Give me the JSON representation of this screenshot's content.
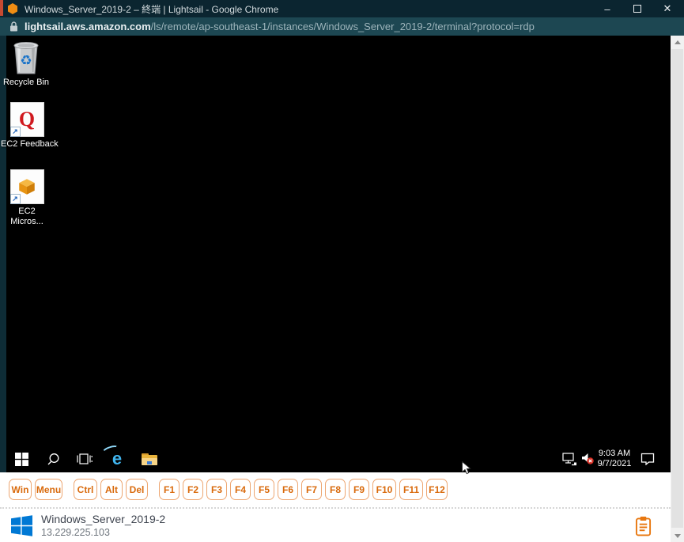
{
  "browser": {
    "title": "Windows_Server_2019-2 – 終端 | Lightsail - Google Chrome",
    "controls": {
      "minimize": "–",
      "close": "✕"
    },
    "url": {
      "domain": "lightsail.aws.amazon.com",
      "path": "/ls/remote/ap-southeast-1/instances/Windows_Server_2019-2/terminal?protocol=rdp"
    }
  },
  "desktop": {
    "icons": [
      {
        "label": "Recycle Bin"
      },
      {
        "label": "EC2 Feedback",
        "glyph": "Q"
      },
      {
        "label_line1": "EC2",
        "label_line2": "Micros..."
      }
    ],
    "taskbar": {
      "clock": {
        "time": "9:03 AM",
        "date": "9/7/2021"
      }
    }
  },
  "icons": {
    "shortcut_arrow": "↗",
    "recycle_symbol": "♻",
    "ie_letter": "e"
  },
  "virtual_keys": {
    "items": [
      "Win",
      "Menu",
      "Ctrl",
      "Alt",
      "Del",
      "F1",
      "F2",
      "F3",
      "F4",
      "F5",
      "F6",
      "F7",
      "F8",
      "F9",
      "F10",
      "F11",
      "F12"
    ]
  },
  "footer": {
    "instance_name": "Windows_Server_2019-2",
    "ip_address": "13.229.225.103"
  },
  "colors": {
    "titlebar": "#0b2530",
    "urlbar": "#1d4752",
    "desktop": "#000000",
    "accent_orange": "#d96a0c",
    "windows_blue": "#0078d4",
    "clipboard_orange": "#e8770f"
  }
}
